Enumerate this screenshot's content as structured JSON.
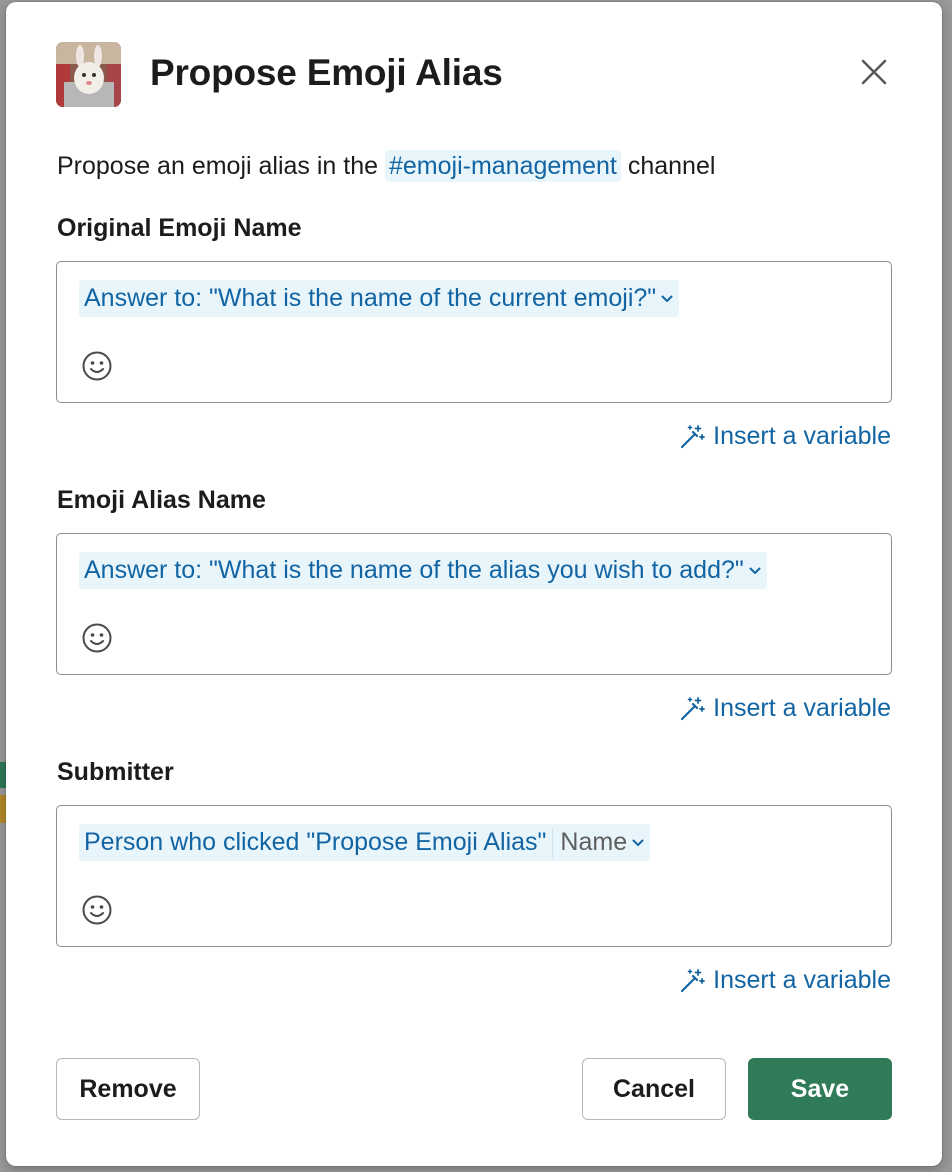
{
  "dialog": {
    "title": "Propose Emoji Alias",
    "intro_prefix": "Propose an emoji alias in the",
    "channel": "#emoji-management",
    "intro_suffix": "channel"
  },
  "fields": [
    {
      "label": "Original Emoji Name",
      "token": "Answer to: \"What is the name of the current emoji?\"",
      "insert_variable": "Insert a variable"
    },
    {
      "label": "Emoji Alias Name",
      "token": "Answer to: \"What is the name of the alias you wish to add?\"",
      "insert_variable": "Insert a variable"
    },
    {
      "label": "Submitter",
      "token": "Person who clicked \"Propose Emoji Alias\"",
      "token_sub": "Name",
      "insert_variable": "Insert a variable"
    }
  ],
  "buttons": {
    "remove": "Remove",
    "cancel": "Cancel",
    "save": "Save"
  },
  "colors": {
    "link": "#1264a3",
    "token_bg": "#e8f5fa",
    "primary": "#2f7b58"
  },
  "icons": {
    "close": "close-icon",
    "emoji": "emoji-smile-icon",
    "insert_variable": "magic-wand-icon",
    "chevron": "chevron-down-icon"
  }
}
